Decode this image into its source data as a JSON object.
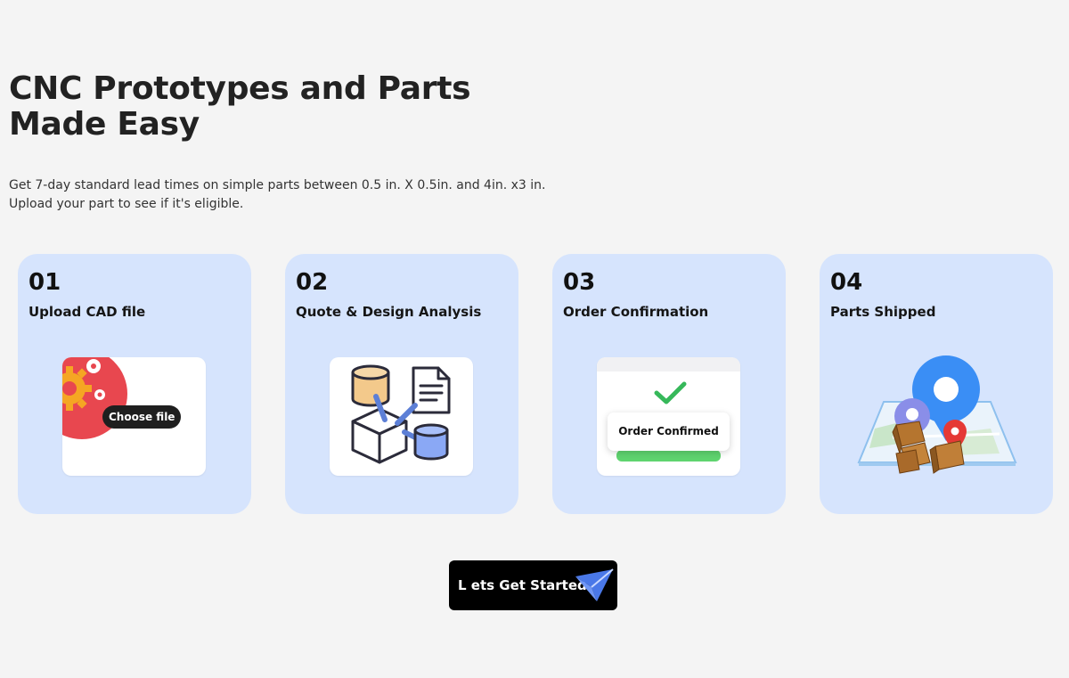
{
  "hero": {
    "title_line1": "CNC Prototypes and Parts",
    "title_line2": "Made Easy",
    "subtitle_line1": "Get 7-day standard lead times on simple parts between 0.5 in. X 0.5in. and 4in. x3 in.",
    "subtitle_line2": "Upload your part to see if it's eligible."
  },
  "steps": [
    {
      "number": "01",
      "label": "Upload CAD file",
      "icon": "upload-gear-icon",
      "button_label": "Choose file"
    },
    {
      "number": "02",
      "label": "Quote & Design Analysis",
      "icon": "design-analysis-icon"
    },
    {
      "number": "03",
      "label": "Order Confirmation",
      "icon": "order-confirmed-icon",
      "confirm_text": "Order Confirmed"
    },
    {
      "number": "04",
      "label": "Parts Shipped",
      "icon": "shipping-map-icon"
    }
  ],
  "cta": {
    "label": "L ets Get Started",
    "icon": "paper-plane-icon"
  },
  "colors": {
    "background": "#f4f4f4",
    "card": "#d6e4fd",
    "cta": "#000000",
    "accent_blue": "#3a8ef5",
    "accent_green": "#36b85a"
  }
}
